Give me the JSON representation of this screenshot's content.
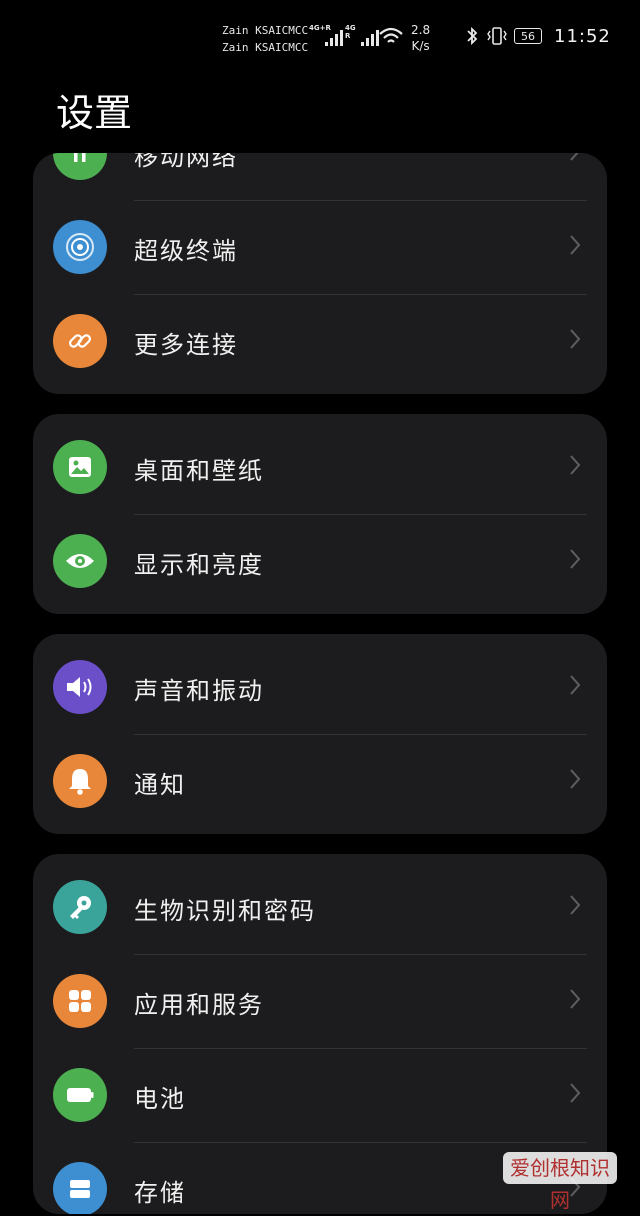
{
  "status_bar": {
    "carrier_1": "Zain KSAICMCC",
    "carrier_2": "Zain KSAICMCC",
    "sim1_tag": "4G+R",
    "sim2_tag": "4G R",
    "speed_value": "2.8",
    "speed_unit": "K/s",
    "battery": "56",
    "time": "11:52"
  },
  "page_title": "设置",
  "groups": [
    {
      "items": [
        {
          "label": "移动网络",
          "icon": "signal-icon",
          "color": "#4caf50"
        },
        {
          "label": "超级终端",
          "icon": "super-device-icon",
          "color": "#3d8fd1"
        },
        {
          "label": "更多连接",
          "icon": "link-icon",
          "color": "#e8873a"
        }
      ]
    },
    {
      "items": [
        {
          "label": "桌面和壁纸",
          "icon": "wallpaper-icon",
          "color": "#4caf50"
        },
        {
          "label": "显示和亮度",
          "icon": "eye-icon",
          "color": "#4caf50"
        }
      ]
    },
    {
      "items": [
        {
          "label": "声音和振动",
          "icon": "speaker-icon",
          "color": "#6a4fc9"
        },
        {
          "label": "通知",
          "icon": "bell-icon",
          "color": "#e8873a"
        }
      ]
    },
    {
      "items": [
        {
          "label": "生物识别和密码",
          "icon": "key-icon",
          "color": "#3aa39a"
        },
        {
          "label": "应用和服务",
          "icon": "apps-icon",
          "color": "#e8873a"
        },
        {
          "label": "电池",
          "icon": "battery-icon",
          "color": "#4caf50"
        },
        {
          "label": "存储",
          "icon": "storage-icon",
          "color": "#3d8fd1"
        }
      ]
    }
  ],
  "watermark": "爱创根知识网"
}
